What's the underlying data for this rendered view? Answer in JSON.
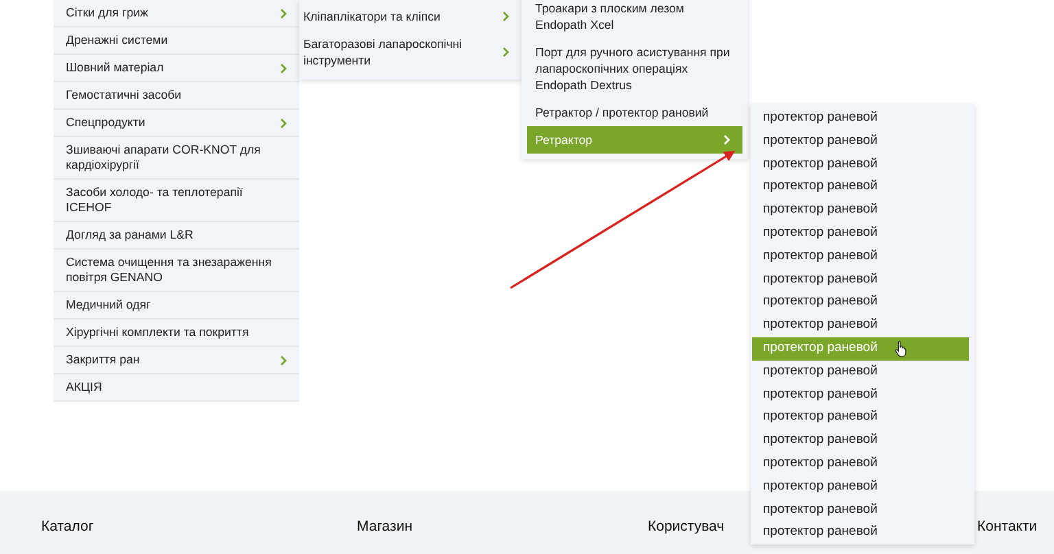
{
  "catalog_menu": {
    "items": [
      {
        "label": "Сітки для гриж",
        "has_submenu": true
      },
      {
        "label": "Дренажні системи",
        "has_submenu": false
      },
      {
        "label": "Шовний матеріал",
        "has_submenu": true
      },
      {
        "label": "Гемостатичні засоби",
        "has_submenu": false
      },
      {
        "label": "Спецпродукти",
        "has_submenu": true
      },
      {
        "label": "Зшиваючі апарати COR-KNOT для кардіохірургії",
        "has_submenu": false
      },
      {
        "label": "Засоби холодо- та теплотерапії ICEHOF",
        "has_submenu": false
      },
      {
        "label": "Догляд за ранами L&R",
        "has_submenu": false
      },
      {
        "label": "Система очищення та знезараження повітря GENANO",
        "has_submenu": false
      },
      {
        "label": "Медичний одяг",
        "has_submenu": false
      },
      {
        "label": "Хірургічні комплекти та покриття",
        "has_submenu": false
      },
      {
        "label": "Закриття ран",
        "has_submenu": true
      },
      {
        "label": "АКЦІЯ",
        "has_submenu": false
      }
    ]
  },
  "submenu_2": {
    "items": [
      {
        "label": "Кліпаплікатори та кліпси",
        "has_submenu": true
      },
      {
        "label": "Багаторазові лапароскопічні інструменти",
        "has_submenu": true
      }
    ]
  },
  "submenu_3": {
    "items": [
      {
        "label": "Троакари з плоским лезом Endopath Xcel",
        "has_submenu": false,
        "selected": false
      },
      {
        "label": "Порт для ручного асистування при лапароскопічних операціях Endopath Dextrus",
        "has_submenu": false,
        "selected": false
      },
      {
        "label": "Ретрактор / протектор рановий",
        "has_submenu": false,
        "selected": false
      },
      {
        "label": "Ретрактор",
        "has_submenu": true,
        "selected": true
      }
    ]
  },
  "submenu_4": {
    "items": [
      {
        "label": "протектор раневой",
        "selected": false
      },
      {
        "label": "протектор раневой",
        "selected": false
      },
      {
        "label": "протектор раневой",
        "selected": false
      },
      {
        "label": "протектор раневой",
        "selected": false
      },
      {
        "label": "протектор раневой",
        "selected": false
      },
      {
        "label": "протектор раневой",
        "selected": false
      },
      {
        "label": "протектор раневой",
        "selected": false
      },
      {
        "label": "протектор раневой",
        "selected": false
      },
      {
        "label": "протектор раневой",
        "selected": false
      },
      {
        "label": "протектор раневой",
        "selected": false
      },
      {
        "label": "протектор раневой",
        "selected": true
      },
      {
        "label": "протектор раневой",
        "selected": false
      },
      {
        "label": "протектор раневой",
        "selected": false
      },
      {
        "label": "протектор раневой",
        "selected": false
      },
      {
        "label": "протектор раневой",
        "selected": false
      },
      {
        "label": "протектор раневой",
        "selected": false
      },
      {
        "label": "протектор раневой",
        "selected": false
      },
      {
        "label": "протектор раневой",
        "selected": false
      },
      {
        "label": "протектор раневой",
        "selected": false
      }
    ]
  },
  "footer": {
    "headings": [
      "Каталог",
      "Магазин",
      "Користувач",
      "Контакти"
    ]
  }
}
